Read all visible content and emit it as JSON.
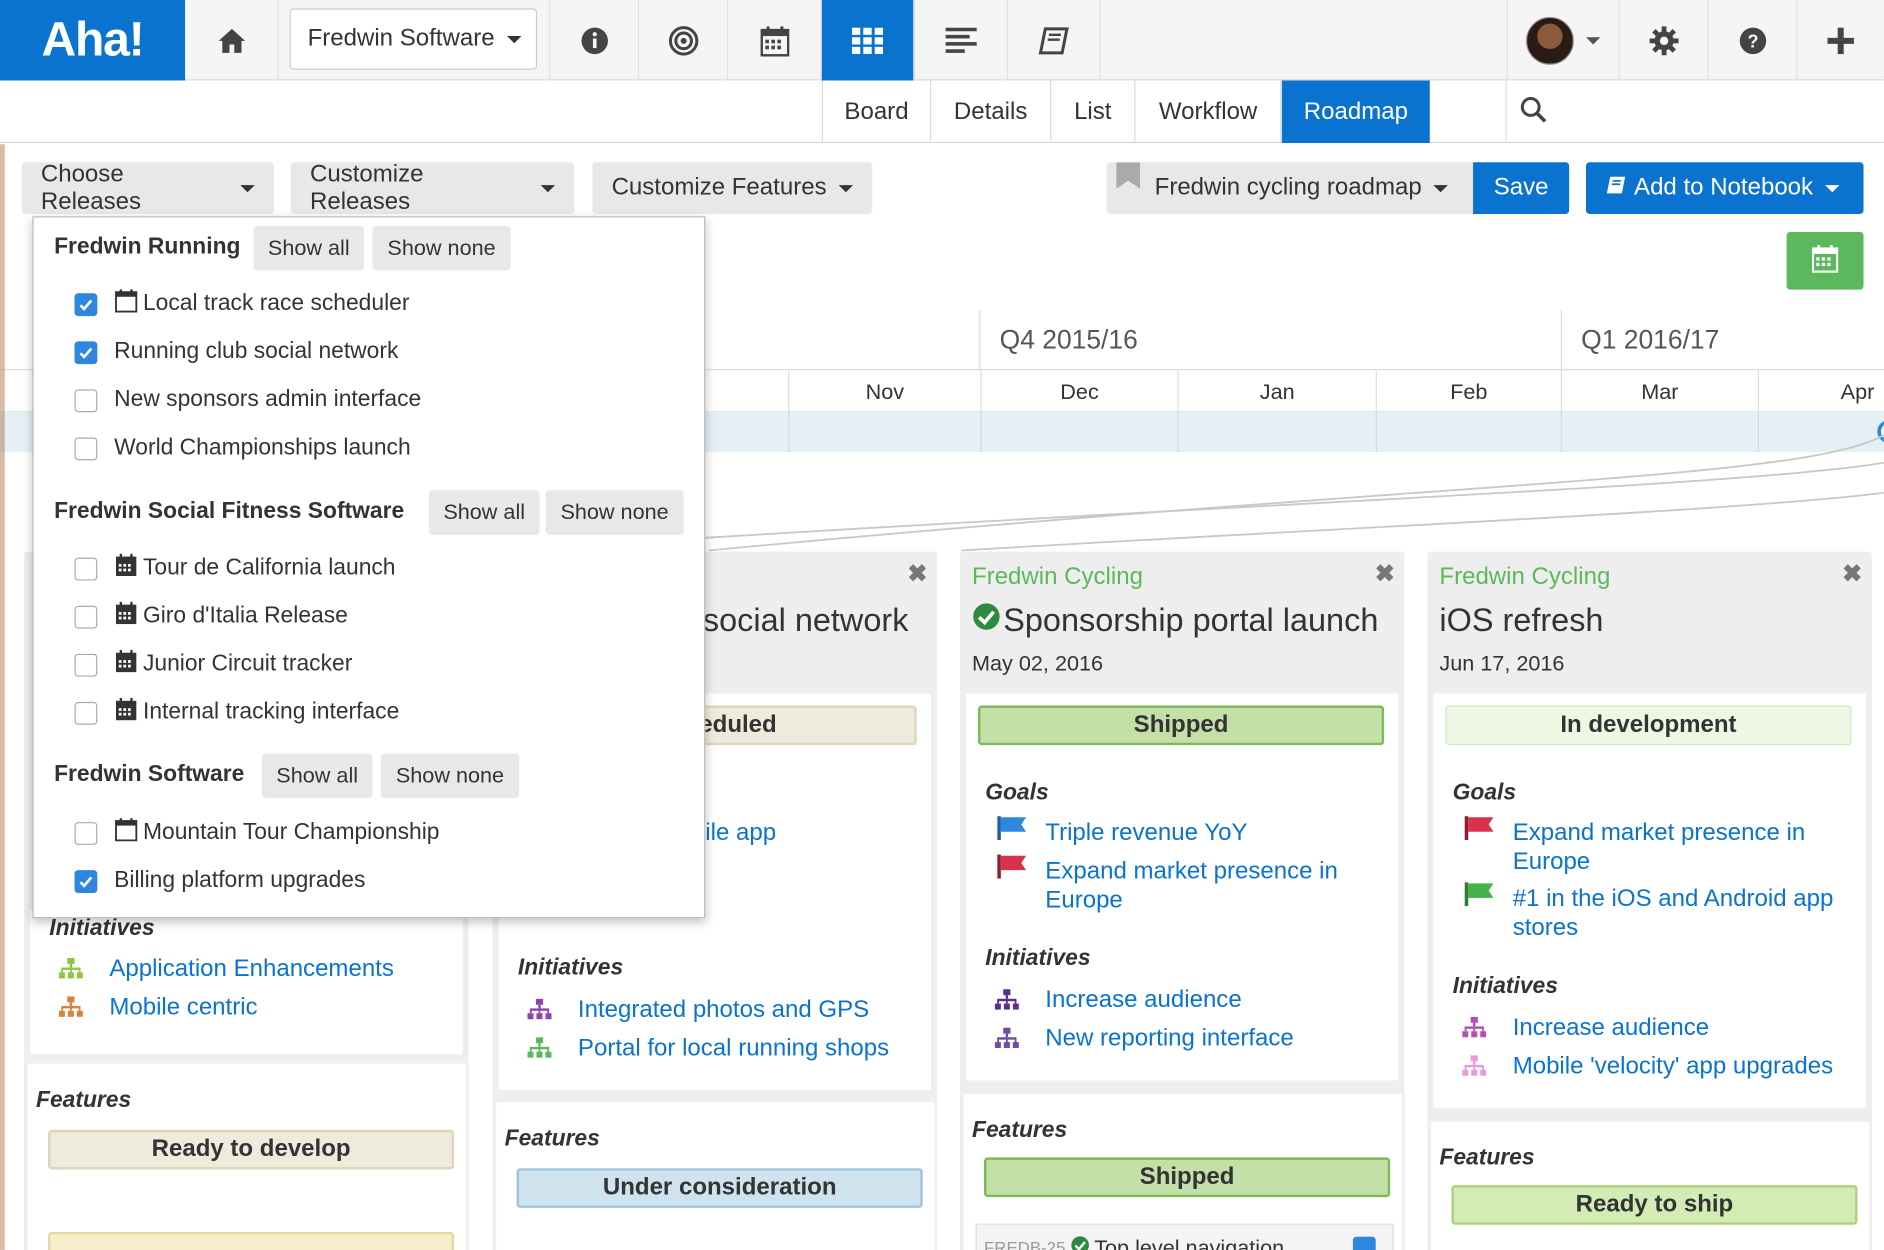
{
  "app": {
    "logo": "Aha!",
    "product": "Fredwin Software"
  },
  "topnav": {
    "icons": [
      "home-icon",
      "info-icon",
      "target-icon",
      "calendar-icon",
      "grid-icon",
      "list-icon",
      "notebook-icon",
      "gear-icon",
      "help-icon",
      "plus-icon"
    ],
    "active": "grid-icon"
  },
  "subnav": {
    "tabs": [
      "Board",
      "Details",
      "List",
      "Workflow",
      "Roadmap"
    ],
    "active": "Roadmap"
  },
  "toolbar": {
    "choose_releases": "Choose Releases",
    "customize_releases": "Customize Releases",
    "customize_features": "Customize Features",
    "roadmap_name": "Fredwin cycling roadmap",
    "save": "Save",
    "add_to_notebook": "Add to Notebook"
  },
  "timeline": {
    "quarters": [
      "Q4 2015/16",
      "Q1 2016/17"
    ],
    "months": [
      "Nov",
      "Dec",
      "Jan",
      "Feb",
      "Mar",
      "Apr"
    ]
  },
  "dropdown": {
    "show_all": "Show all",
    "show_none": "Show none",
    "groups": [
      {
        "name": "Fredwin Running",
        "items": [
          {
            "label": "Local track race scheduler",
            "checked": true,
            "icon": "calendar-outline"
          },
          {
            "label": "Running club social network",
            "checked": true,
            "icon": ""
          },
          {
            "label": "New sponsors admin interface",
            "checked": false,
            "icon": ""
          },
          {
            "label": "World Championships launch",
            "checked": false,
            "icon": ""
          }
        ]
      },
      {
        "name": "Fredwin Social Fitness Software",
        "items": [
          {
            "label": "Tour de California launch",
            "checked": false,
            "icon": "calendar-filled"
          },
          {
            "label": "Giro d'Italia Release",
            "checked": false,
            "icon": "calendar-filled"
          },
          {
            "label": "Junior Circuit tracker",
            "checked": false,
            "icon": "calendar-filled"
          },
          {
            "label": "Internal tracking interface",
            "checked": false,
            "icon": "calendar-filled"
          }
        ]
      },
      {
        "name": "Fredwin Software",
        "items": [
          {
            "label": "Mountain Tour Championship",
            "checked": false,
            "icon": "calendar-outline"
          },
          {
            "label": "Billing platform upgrades",
            "checked": true,
            "icon": ""
          }
        ]
      }
    ]
  },
  "cards": {
    "c1": {
      "initiatives_label": "Initiatives",
      "initiatives": [
        "Application Enhancements",
        "Mobile centric"
      ],
      "features_label": "Features",
      "features_status": "Ready to develop"
    },
    "c2": {
      "title_partial": "social network",
      "status_partial": "eduled",
      "goal_partial": "ile app",
      "initiatives_label": "Initiatives",
      "initiatives": [
        "Integrated photos and GPS",
        "Portal for local running shops"
      ],
      "features_label": "Features",
      "features_status": "Under consideration"
    },
    "c3": {
      "product": "Fredwin Cycling",
      "title": "Sponsorship portal launch",
      "date": "May 02, 2016",
      "status": "Shipped",
      "goals_label": "Goals",
      "goals": [
        "Triple revenue YoY",
        "Expand market presence in Europe"
      ],
      "initiatives_label": "Initiatives",
      "initiatives": [
        "Increase audience",
        "New reporting interface"
      ],
      "features_label": "Features",
      "features_status": "Shipped",
      "feature_id": "FREDB-25",
      "feature_name": "Top level navigation"
    },
    "c4": {
      "product": "Fredwin Cycling",
      "title": "iOS refresh",
      "date": "Jun 17, 2016",
      "status": "In development",
      "goals_label": "Goals",
      "goals": [
        "Expand market presence in Europe",
        "#1 in the iOS and Android app stores"
      ],
      "initiatives_label": "Initiatives",
      "initiatives": [
        "Increase audience",
        "Mobile 'velocity' app upgrades"
      ],
      "features_label": "Features",
      "features_status": "Ready to ship"
    }
  },
  "colors": {
    "brand_blue": "#0a73d0",
    "green": "#5cb85c",
    "link": "#0a73d0"
  }
}
